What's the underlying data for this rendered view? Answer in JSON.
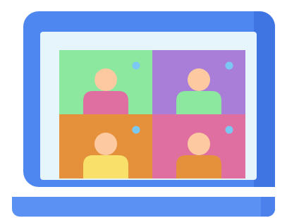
{
  "illustration": {
    "icon": "video-conference-laptop-icon",
    "colors": {
      "laptop_body": "#4f87f0",
      "laptop_body_shade": "#3f74e3",
      "laptop_base": "#5a91f3",
      "laptop_base_shade": "#4c80ea",
      "screen": "#e6f4fb",
      "dot": "#7cc8f4",
      "skin": "#fdc9a0"
    },
    "tiles": [
      {
        "position": "top-left",
        "background": "#8ce89f",
        "shirt": "#df6fa0"
      },
      {
        "position": "top-right",
        "background": "#a97ed9",
        "shirt": "#8ce89f"
      },
      {
        "position": "bottom-left",
        "background": "#e5913c",
        "shirt": "#f8e06a"
      },
      {
        "position": "bottom-right",
        "background": "#df6fa0",
        "shirt": "#e5913c"
      }
    ]
  }
}
